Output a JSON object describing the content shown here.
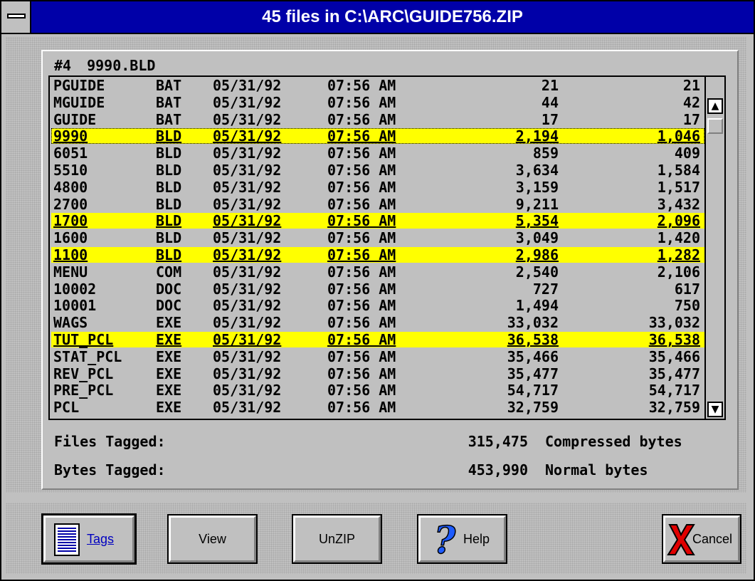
{
  "window": {
    "title": "45 files in C:\\ARC\\GUIDE756.ZIP"
  },
  "selection": {
    "index": "#4",
    "file": "9990.BLD"
  },
  "files": [
    {
      "name": "PGUIDE",
      "ext": "BAT",
      "date": "05/31/92",
      "time": "07:56 AM",
      "size": "21",
      "compressed": "21",
      "tagged": false,
      "focused": false
    },
    {
      "name": "MGUIDE",
      "ext": "BAT",
      "date": "05/31/92",
      "time": "07:56 AM",
      "size": "44",
      "compressed": "42",
      "tagged": false,
      "focused": false
    },
    {
      "name": "GUIDE",
      "ext": "BAT",
      "date": "05/31/92",
      "time": "07:56 AM",
      "size": "17",
      "compressed": "17",
      "tagged": false,
      "focused": false
    },
    {
      "name": "9990",
      "ext": "BLD",
      "date": "05/31/92",
      "time": "07:56 AM",
      "size": "2,194",
      "compressed": "1,046",
      "tagged": true,
      "focused": true
    },
    {
      "name": "6051",
      "ext": "BLD",
      "date": "05/31/92",
      "time": "07:56 AM",
      "size": "859",
      "compressed": "409",
      "tagged": false,
      "focused": false
    },
    {
      "name": "5510",
      "ext": "BLD",
      "date": "05/31/92",
      "time": "07:56 AM",
      "size": "3,634",
      "compressed": "1,584",
      "tagged": false,
      "focused": false
    },
    {
      "name": "4800",
      "ext": "BLD",
      "date": "05/31/92",
      "time": "07:56 AM",
      "size": "3,159",
      "compressed": "1,517",
      "tagged": false,
      "focused": false
    },
    {
      "name": "2700",
      "ext": "BLD",
      "date": "05/31/92",
      "time": "07:56 AM",
      "size": "9,211",
      "compressed": "3,432",
      "tagged": false,
      "focused": false
    },
    {
      "name": "1700",
      "ext": "BLD",
      "date": "05/31/92",
      "time": "07:56 AM",
      "size": "5,354",
      "compressed": "2,096",
      "tagged": true,
      "focused": false
    },
    {
      "name": "1600",
      "ext": "BLD",
      "date": "05/31/92",
      "time": "07:56 AM",
      "size": "3,049",
      "compressed": "1,420",
      "tagged": false,
      "focused": false
    },
    {
      "name": "1100",
      "ext": "BLD",
      "date": "05/31/92",
      "time": "07:56 AM",
      "size": "2,986",
      "compressed": "1,282",
      "tagged": true,
      "focused": false
    },
    {
      "name": "MENU",
      "ext": "COM",
      "date": "05/31/92",
      "time": "07:56 AM",
      "size": "2,540",
      "compressed": "2,106",
      "tagged": false,
      "focused": false
    },
    {
      "name": "10002",
      "ext": "DOC",
      "date": "05/31/92",
      "time": "07:56 AM",
      "size": "727",
      "compressed": "617",
      "tagged": false,
      "focused": false
    },
    {
      "name": "10001",
      "ext": "DOC",
      "date": "05/31/92",
      "time": "07:56 AM",
      "size": "1,494",
      "compressed": "750",
      "tagged": false,
      "focused": false
    },
    {
      "name": "WAGS",
      "ext": "EXE",
      "date": "05/31/92",
      "time": "07:56 AM",
      "size": "33,032",
      "compressed": "33,032",
      "tagged": false,
      "focused": false
    },
    {
      "name": "TUT_PCL",
      "ext": "EXE",
      "date": "05/31/92",
      "time": "07:56 AM",
      "size": "36,538",
      "compressed": "36,538",
      "tagged": true,
      "focused": false
    },
    {
      "name": "STAT_PCL",
      "ext": "EXE",
      "date": "05/31/92",
      "time": "07:56 AM",
      "size": "35,466",
      "compressed": "35,466",
      "tagged": false,
      "focused": false
    },
    {
      "name": "REV_PCL",
      "ext": "EXE",
      "date": "05/31/92",
      "time": "07:56 AM",
      "size": "35,477",
      "compressed": "35,477",
      "tagged": false,
      "focused": false
    },
    {
      "name": "PRE_PCL",
      "ext": "EXE",
      "date": "05/31/92",
      "time": "07:56 AM",
      "size": "54,717",
      "compressed": "54,717",
      "tagged": false,
      "focused": false
    },
    {
      "name": "PCL",
      "ext": "EXE",
      "date": "05/31/92",
      "time": "07:56 AM",
      "size": "32,759",
      "compressed": "32,759",
      "tagged": false,
      "focused": false
    }
  ],
  "totals": {
    "files_label": "Files Tagged:",
    "bytes_label": "Bytes Tagged:",
    "compressed_value": "315,475",
    "compressed_label": "Compressed bytes",
    "normal_value": "453,990",
    "normal_label": "Normal bytes"
  },
  "buttons": {
    "tags": "Tags",
    "view": "View",
    "unzip": "UnZIP",
    "help": "Help",
    "cancel": "Cancel"
  },
  "colors": {
    "titlebar": "#0000a8",
    "tag_highlight": "#ffff00",
    "face": "#c0c0c0"
  }
}
